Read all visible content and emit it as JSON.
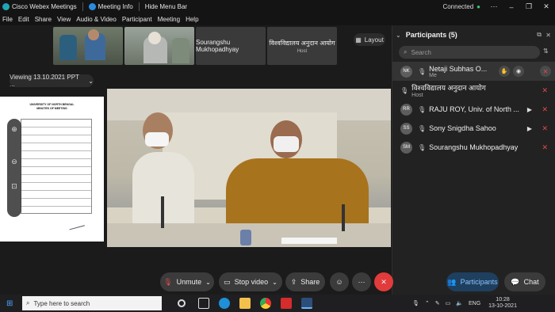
{
  "app": {
    "title": "Cisco Webex Meetings",
    "meeting_info": "Meeting Info",
    "hide_menu": "Hide Menu Bar",
    "status": "Connected"
  },
  "menu": [
    "File",
    "Edit",
    "Share",
    "View",
    "Audio & Video",
    "Participant",
    "Meeting",
    "Help"
  ],
  "thumbnails": [
    {
      "name": "Sourangshu Mukhopadhyay",
      "role": ""
    },
    {
      "name": "विश्वविद्यालय अनुदान आयोग",
      "role": "Host"
    }
  ],
  "layout_label": "Layout",
  "viewing_label": "Viewing 13.10.2021 PPT ...",
  "document": {
    "heading_line1": "UNIVERSITY OF NORTH BENGAL",
    "heading_line2": "MINUTES OF MEETING"
  },
  "participants_panel": {
    "title": "Participants (5)",
    "search_placeholder": "Search",
    "items": [
      {
        "initials": "NK",
        "name": "Netaji Subhas O...",
        "sub": "Me"
      },
      {
        "initials": "",
        "name": "विश्वविद्यालय अनुदान आयोग",
        "sub": "Host"
      },
      {
        "initials": "RR",
        "name": "RAJU ROY, Univ. of North ...",
        "sub": ""
      },
      {
        "initials": "SS",
        "name": "Sony Snigdha Sahoo",
        "sub": ""
      },
      {
        "initials": "SM",
        "name": "Sourangshu Mukhopadhyay",
        "sub": ""
      }
    ]
  },
  "controls": {
    "unmute": "Unmute",
    "stop_video": "Stop video",
    "share": "Share",
    "participants": "Participants",
    "chat": "Chat"
  },
  "taskbar": {
    "search_placeholder": "Type here to search",
    "lang": "ENG",
    "time": "10:28",
    "date": "13-10-2021"
  },
  "colors": {
    "accent": "#2a8ce0",
    "end_call": "#e23b3b",
    "active_button": "#1f5f9a"
  }
}
